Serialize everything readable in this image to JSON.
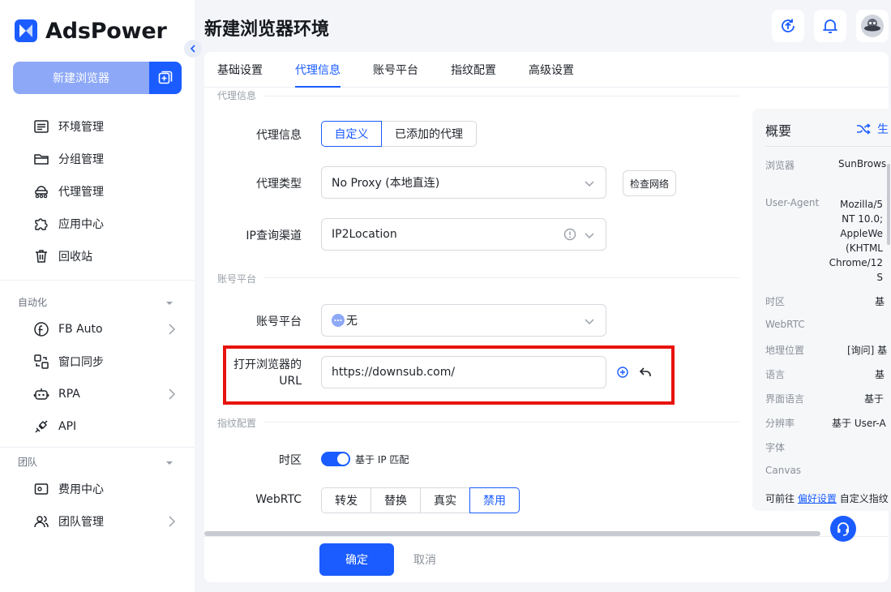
{
  "app": {
    "name": "AdsPower",
    "accent": "#1a5cff",
    "highlight": "#e8130d"
  },
  "sidebar": {
    "new_browser_label": "新建浏览器",
    "items": [
      {
        "label": "环境管理",
        "icon": "list-icon"
      },
      {
        "label": "分组管理",
        "icon": "folder-icon"
      },
      {
        "label": "代理管理",
        "icon": "proxy-icon"
      },
      {
        "label": "应用中心",
        "icon": "puzzle-icon"
      },
      {
        "label": "回收站",
        "icon": "trash-icon"
      }
    ],
    "automation_title": "自动化",
    "automation_items": [
      {
        "label": "FB Auto",
        "icon": "facebook-icon"
      },
      {
        "label": "窗口同步",
        "icon": "sync-icon"
      },
      {
        "label": "RPA",
        "icon": "robot-icon"
      },
      {
        "label": "API",
        "icon": "api-icon"
      }
    ],
    "team_title": "团队",
    "team_items": [
      {
        "label": "费用中心",
        "icon": "wallet-icon"
      },
      {
        "label": "团队管理",
        "icon": "team-icon"
      }
    ]
  },
  "header": {
    "title": "新建浏览器环境"
  },
  "tabs": [
    {
      "label": "基础设置"
    },
    {
      "label": "代理信息"
    },
    {
      "label": "账号平台"
    },
    {
      "label": "指纹配置"
    },
    {
      "label": "高级设置"
    }
  ],
  "form": {
    "proxy_group_title": "代理信息",
    "proxy_info_label": "代理信息",
    "proxy_info_options": [
      "自定义",
      "已添加的代理"
    ],
    "proxy_type_label": "代理类型",
    "proxy_type_value": "No Proxy (本地直连)",
    "check_network_label": "检查网络",
    "ip_channel_label": "IP查询渠道",
    "ip_channel_value": "IP2Location",
    "account_group_title": "账号平台",
    "account_platform_label": "账号平台",
    "account_platform_value": "无",
    "url_label_line1": "打开浏览器的",
    "url_label_line2": "URL",
    "url_value": "https://downsub.com/",
    "fingerprint_group_title": "指纹配置",
    "timezone_label": "时区",
    "timezone_value": "基于 IP 匹配",
    "webrtc_label": "WebRTC",
    "webrtc_options": [
      "转发",
      "替换",
      "真实",
      "禁用"
    ]
  },
  "footer": {
    "ok_label": "确定",
    "cancel_label": "取消"
  },
  "summary": {
    "title": "概要",
    "generate_label": "生",
    "rows": [
      {
        "key": "浏览器",
        "value": "SunBrows"
      },
      {
        "key": "User-Agent",
        "value_lines": [
          "Mozilla/5",
          "NT 10.0;",
          "AppleWe",
          "(KHTML",
          "Chrome/12",
          "S"
        ]
      },
      {
        "key": "时区",
        "value": "基"
      },
      {
        "key": "WebRTC",
        "value": ""
      },
      {
        "key": "地理位置",
        "value": "[询问] 基"
      },
      {
        "key": "语言",
        "value": "基"
      },
      {
        "key": "界面语言",
        "value": "基于"
      },
      {
        "key": "分辨率",
        "value": "基于 User-A"
      },
      {
        "key": "字体",
        "value": ""
      },
      {
        "key": "Canvas",
        "value": ""
      }
    ],
    "footer_prefix": "可前往",
    "footer_link": "偏好设置",
    "footer_suffix": "自定义指纹"
  }
}
